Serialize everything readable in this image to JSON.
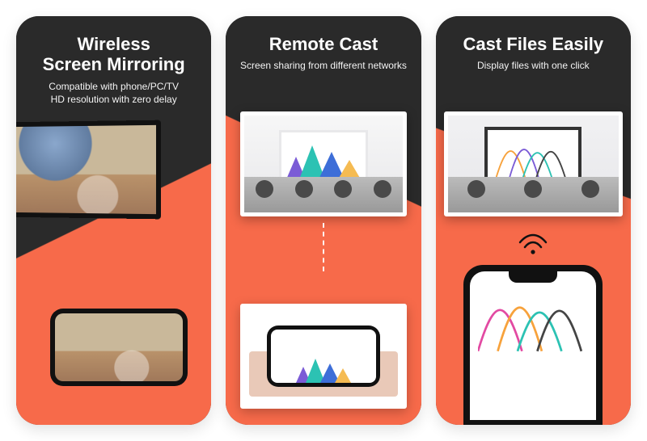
{
  "cards": [
    {
      "title": "Wireless\nScreen Mirroring",
      "subtitle": "Compatible with phone/PC/TV\nHD resolution with zero delay"
    },
    {
      "title": "Remote Cast",
      "subtitle": "Screen sharing from different networks"
    },
    {
      "title": "Cast Files Easily",
      "subtitle": "Display files with one click"
    }
  ],
  "colors": {
    "accent": "#f76a4a",
    "dark": "#2a2a2a"
  }
}
